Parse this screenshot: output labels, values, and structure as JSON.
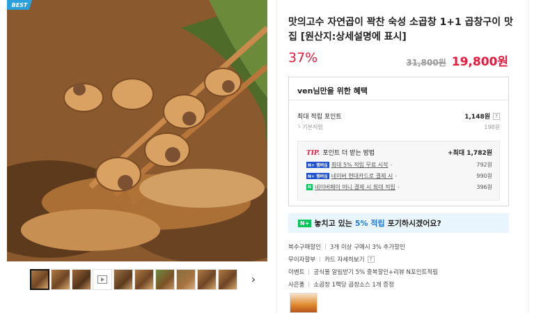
{
  "gallery": {
    "badge": "BEST",
    "thumbnail_count": 10,
    "next_label": "›"
  },
  "product": {
    "title": "맛의고수 자연곱이 꽉찬 숙성 소곱창 1+1 곱창구이 맛집 [원산지:상세설명에 표시]",
    "discount": "37%",
    "original_price": "31,800원",
    "sale_price": "19,800원"
  },
  "benefits": {
    "header": "ven님만을 위한 혜택",
    "max_points_label": "최대 적립 포인트",
    "max_points_value": "1,148원",
    "help": "?",
    "base_label": "기본적립",
    "base_value": "198원",
    "tip_label": "TIP.",
    "tip_text": "포인트 더 받는 방법",
    "tip_max": "+최대 1,782원",
    "tips": [
      {
        "badge": "N+ 멤버십",
        "text": "최대 5% 적립 무료 시작",
        "value": "792원"
      },
      {
        "badge": "N+ 멤버십",
        "text": "네이버 현대카드로 결제 시",
        "value": "990원"
      },
      {
        "badge": "N",
        "text": "네이버페이 머니 결제 시 최대 적립",
        "value": "396원"
      }
    ]
  },
  "banner": {
    "badge": "N+",
    "text_prefix": "놓치고 있는",
    "highlight": "5% 적립",
    "text_suffix": "포기하시겠어요?"
  },
  "info": [
    {
      "label": "복수구매할인",
      "value": "3개 이상 구매시 3% 추가할인"
    },
    {
      "label": "무이자할부",
      "value": "카드 자세히보기"
    },
    {
      "label": "이벤트",
      "value": "공식몰 알림받기 5% 중복할인+리뷰 N포인트적립"
    },
    {
      "label": "사은품",
      "value": "소곱창 1팩당 곱창소스 1개 증정"
    }
  ],
  "colors": {
    "accent_red": "#e8193c",
    "naver_green": "#03c75a",
    "badge_blue": "#2aa0de",
    "banner_bg": "#e9f5fc"
  }
}
